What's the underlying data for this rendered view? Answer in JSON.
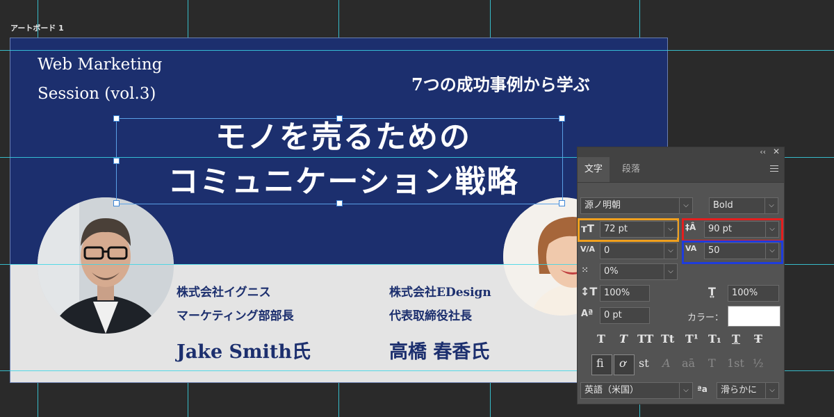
{
  "artboard": {
    "label": "アートボード 1"
  },
  "banner": {
    "session_line1": "Web Marketing",
    "session_line2": "Session (vol.3)",
    "subtitle": "7つの成功事例から学ぶ",
    "headline_line1": "モノを売るための",
    "headline_line2": "コミュニケーション戦略",
    "colors": {
      "navy": "#1c2f6e",
      "light": "#e4e4e4"
    }
  },
  "speakers": [
    {
      "company": "株式会社イグニス",
      "role": "マーケティング部部長",
      "name": "Jake Smith氏"
    },
    {
      "company": "株式会社EDesign",
      "role": "代表取締役社長",
      "name": "高橋 春香氏"
    }
  ],
  "panel": {
    "tabs": [
      "文字",
      "段落"
    ],
    "font_family": "源ノ明朝",
    "font_style": "Bold",
    "font_size": "72 pt",
    "leading": "90 pt",
    "kerning": "0",
    "tracking": "50",
    "tsume": "0%",
    "vertical_scale": "100%",
    "horizontal_scale": "100%",
    "baseline_shift": "0 pt",
    "color_label": "カラー：",
    "color_value": "#ffffff",
    "style_buttons": [
      "T",
      "T",
      "TT",
      "Tt",
      "T¹",
      "T₁",
      "T",
      "T"
    ],
    "feature_buttons": [
      "fi",
      "ơ",
      "st",
      "A",
      "aā",
      "T",
      "1st",
      "½"
    ],
    "language": "英語（米国）",
    "aa_label": "ªa",
    "antialias": "滑らかに",
    "icons": {
      "font_size": "font-size-icon",
      "leading": "leading-icon",
      "kerning": "kerning-icon",
      "tracking": "tracking-icon",
      "tsume": "tsume-icon",
      "vscale": "vertical-scale-icon",
      "hscale": "horizontal-scale-icon",
      "baseline": "baseline-shift-icon"
    },
    "highlight_colors": {
      "orange": "#f0a01e",
      "red": "#e41e1e",
      "blue": "#1e3cdc"
    }
  }
}
